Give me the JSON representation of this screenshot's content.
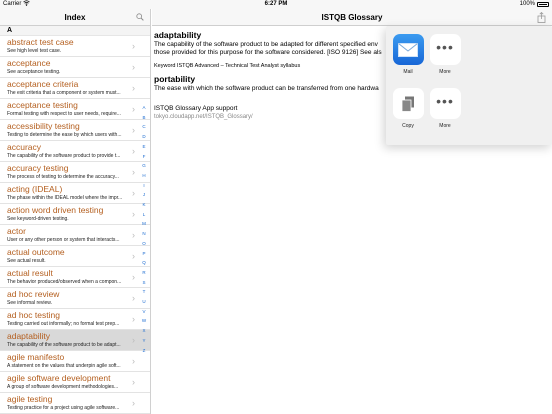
{
  "status_bar": {
    "carrier": "Carrier",
    "time": "6:27 PM",
    "battery": "100%"
  },
  "left_pane": {
    "title": "Index",
    "section": "A",
    "items": [
      {
        "term": "abstract test case",
        "def": "See high level test case."
      },
      {
        "term": "acceptance",
        "def": "See acceptance testing."
      },
      {
        "term": "acceptance criteria",
        "def": "The exit criteria that a component or system must..."
      },
      {
        "term": "acceptance testing",
        "def": "Formal testing with respect to user needs, require..."
      },
      {
        "term": "accessibility testing",
        "def": "Testing to determine the ease by which users with..."
      },
      {
        "term": "accuracy",
        "def": "The capability of the software product to provide t..."
      },
      {
        "term": "accuracy testing",
        "def": "The process of testing to determine the accuracy..."
      },
      {
        "term": "acting (IDEAL)",
        "def": "The phase within the IDEAL model where the impr..."
      },
      {
        "term": "action word driven testing",
        "def": "See keyword-driven testing."
      },
      {
        "term": "actor",
        "def": "User or any other person or system that interacts..."
      },
      {
        "term": "actual outcome",
        "def": "See actual result."
      },
      {
        "term": "actual result",
        "def": "The behavior produced/observed when a compon..."
      },
      {
        "term": "ad hoc review",
        "def": "See informal review."
      },
      {
        "term": "ad hoc testing",
        "def": "Testing carried out informally; no formal test prep..."
      },
      {
        "term": "adaptability",
        "def": "The capability of the software product to be adapt..."
      },
      {
        "term": "agile manifesto",
        "def": "A statement on the values that underpin agile soft..."
      },
      {
        "term": "agile software development",
        "def": "A group of software development methodologies..."
      },
      {
        "term": "agile testing",
        "def": "Testing practice for a project using agile software..."
      }
    ],
    "selected_index": 14,
    "index_letters": [
      "A",
      "B",
      "C",
      "D",
      "E",
      "F",
      "G",
      "H",
      "I",
      "J",
      "K",
      "L",
      "M",
      "N",
      "O",
      "P",
      "Q",
      "R",
      "S",
      "T",
      "U",
      "V",
      "W",
      "X",
      "Y",
      "Z"
    ]
  },
  "right_pane": {
    "title": "ISTQB Glossary",
    "entry1_title": "adaptability",
    "entry1_def_line1": "The capability of the software product to be adapted for different specified env",
    "entry1_def_line2": "those provided for this purpose for the software considered. [ISO 9126] See als",
    "entry1_source": "Keyword ISTQB Advanced – Technical Test Analyst syllabus",
    "entry2_title": "portability",
    "entry2_def": "The ease with which the software product can be transferred from one hardwa",
    "support_title": "ISTQB Glossary App support",
    "support_url": "tokyo.cloudapp.net/ISTQB_Glossary/"
  },
  "share_sheet": {
    "row1": [
      {
        "label": "Mail",
        "icon": "mail-icon"
      },
      {
        "label": "More",
        "icon": "more-icon"
      }
    ],
    "row2": [
      {
        "label": "Copy",
        "icon": "copy-icon"
      },
      {
        "label": "More",
        "icon": "more-icon"
      }
    ]
  }
}
